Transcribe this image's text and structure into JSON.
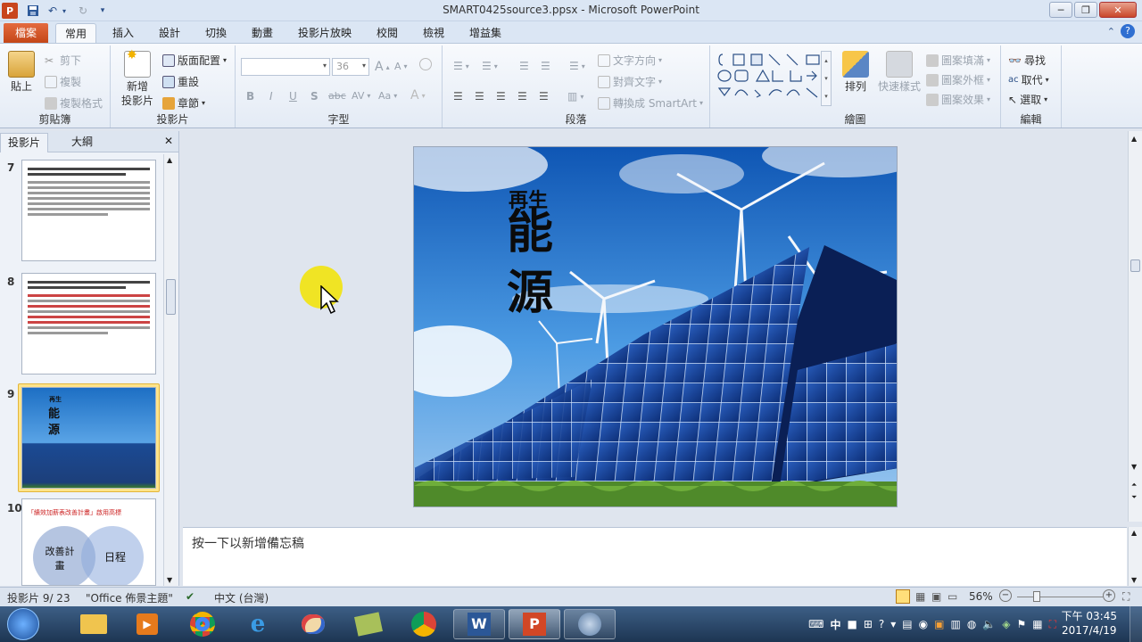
{
  "window": {
    "title": "SMART0425source3.ppsx - Microsoft PowerPoint",
    "buttons": {
      "minimize": "─",
      "restore": "❐",
      "close": "✕"
    }
  },
  "tabs": [
    {
      "label": "檔案"
    },
    {
      "label": "常用"
    },
    {
      "label": "插入"
    },
    {
      "label": "設計"
    },
    {
      "label": "切換"
    },
    {
      "label": "動畫"
    },
    {
      "label": "投影片放映"
    },
    {
      "label": "校閱"
    },
    {
      "label": "檢視"
    },
    {
      "label": "增益集"
    }
  ],
  "ribbon": {
    "clipboard": {
      "group": "剪貼簿",
      "paste": "貼上",
      "cut": "剪下",
      "copy": "複製",
      "format_painter": "複製格式"
    },
    "slides": {
      "group": "投影片",
      "new_slide_1": "新增",
      "new_slide_2": "投影片",
      "layout": "版面配置",
      "reset": "重設",
      "section": "章節"
    },
    "font": {
      "group": "字型",
      "font_name": "",
      "font_size": "36",
      "bold": "B",
      "italic": "I",
      "underline": "U",
      "shadow": "S",
      "strike": "abc",
      "spacing": "AV",
      "case": "Aa",
      "grow": "A",
      "shrink": "A"
    },
    "paragraph": {
      "group": "段落",
      "text_direction": "文字方向",
      "align_text": "對齊文字",
      "smartart": "轉換成 SmartArt"
    },
    "drawing": {
      "group": "繪圖",
      "arrange": "排列",
      "quick_styles": "快速樣式",
      "fill": "圖案填滿",
      "outline": "圖案外框",
      "effects": "圖案效果"
    },
    "editing": {
      "group": "編輯",
      "find": "尋找",
      "replace": "取代",
      "select": "選取"
    }
  },
  "left_pane": {
    "tabs": [
      "投影片",
      "大綱"
    ],
    "close": "✕",
    "slides": [
      {
        "num": "7"
      },
      {
        "num": "8"
      },
      {
        "num": "9",
        "t1": "再生",
        "t2": "能",
        "t3": "源"
      },
      {
        "num": "10",
        "heading": "「績效加薪表改善計畫」啟用高標",
        "circle1": "改善計畫",
        "circle2": "日程"
      }
    ]
  },
  "slide": {
    "title_small": "再生",
    "title_char1": "能",
    "title_char2": "源"
  },
  "notes": {
    "placeholder": "按一下以新增備忘稿"
  },
  "status": {
    "slide_info": "投影片 9/ 23",
    "theme": "\"Office 佈景主題\"",
    "language": "中文 (台灣)",
    "zoom": "56%"
  },
  "taskbar": {
    "clock_time": "下午 03:45",
    "clock_date": "2017/4/19",
    "ime": "中"
  },
  "colors": {
    "file_tab": "#d35425",
    "ribbon_bg": "#e4ebf5",
    "selected_thumb": "#ffe48a",
    "cursor_highlight": "#ffeb00"
  }
}
